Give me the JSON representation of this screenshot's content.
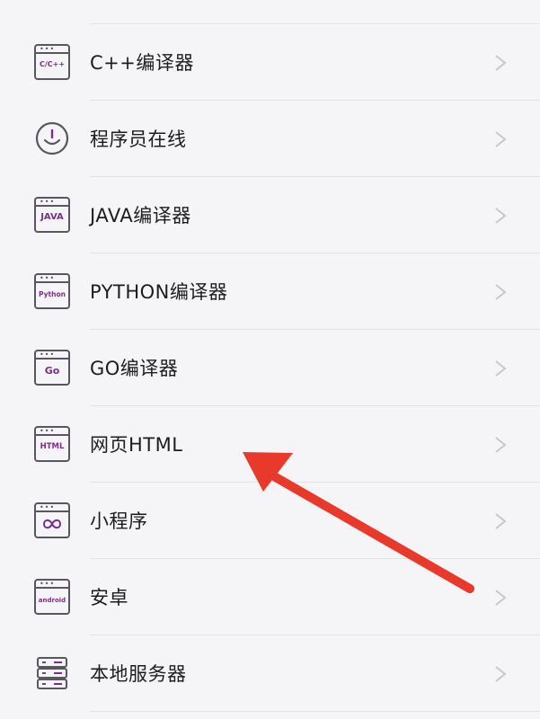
{
  "colors": {
    "background": "#f5f4f6",
    "divider": "#e3e1e5",
    "icon_stroke": "#5a5560",
    "icon_accent": "#7a2f8c",
    "chevron": "#c9c7cc",
    "arrow": "#e8392a"
  },
  "items": [
    {
      "label": "C++编译器",
      "icon": "cpp-compiler-icon",
      "icon_text": "C/C++"
    },
    {
      "label": "程序员在线",
      "icon": "programmer-online-icon",
      "icon_text": ""
    },
    {
      "label": "JAVA编译器",
      "icon": "java-compiler-icon",
      "icon_text": "JAVA"
    },
    {
      "label": "PYTHON编译器",
      "icon": "python-compiler-icon",
      "icon_text": "Python"
    },
    {
      "label": "GO编译器",
      "icon": "go-compiler-icon",
      "icon_text": "Go"
    },
    {
      "label": "网页HTML",
      "icon": "html-icon",
      "icon_text": "HTML"
    },
    {
      "label": "小程序",
      "icon": "mini-program-icon",
      "icon_text": ""
    },
    {
      "label": "安卓",
      "icon": "android-icon",
      "icon_text": "android"
    },
    {
      "label": "本地服务器",
      "icon": "local-server-icon",
      "icon_text": ""
    }
  ]
}
